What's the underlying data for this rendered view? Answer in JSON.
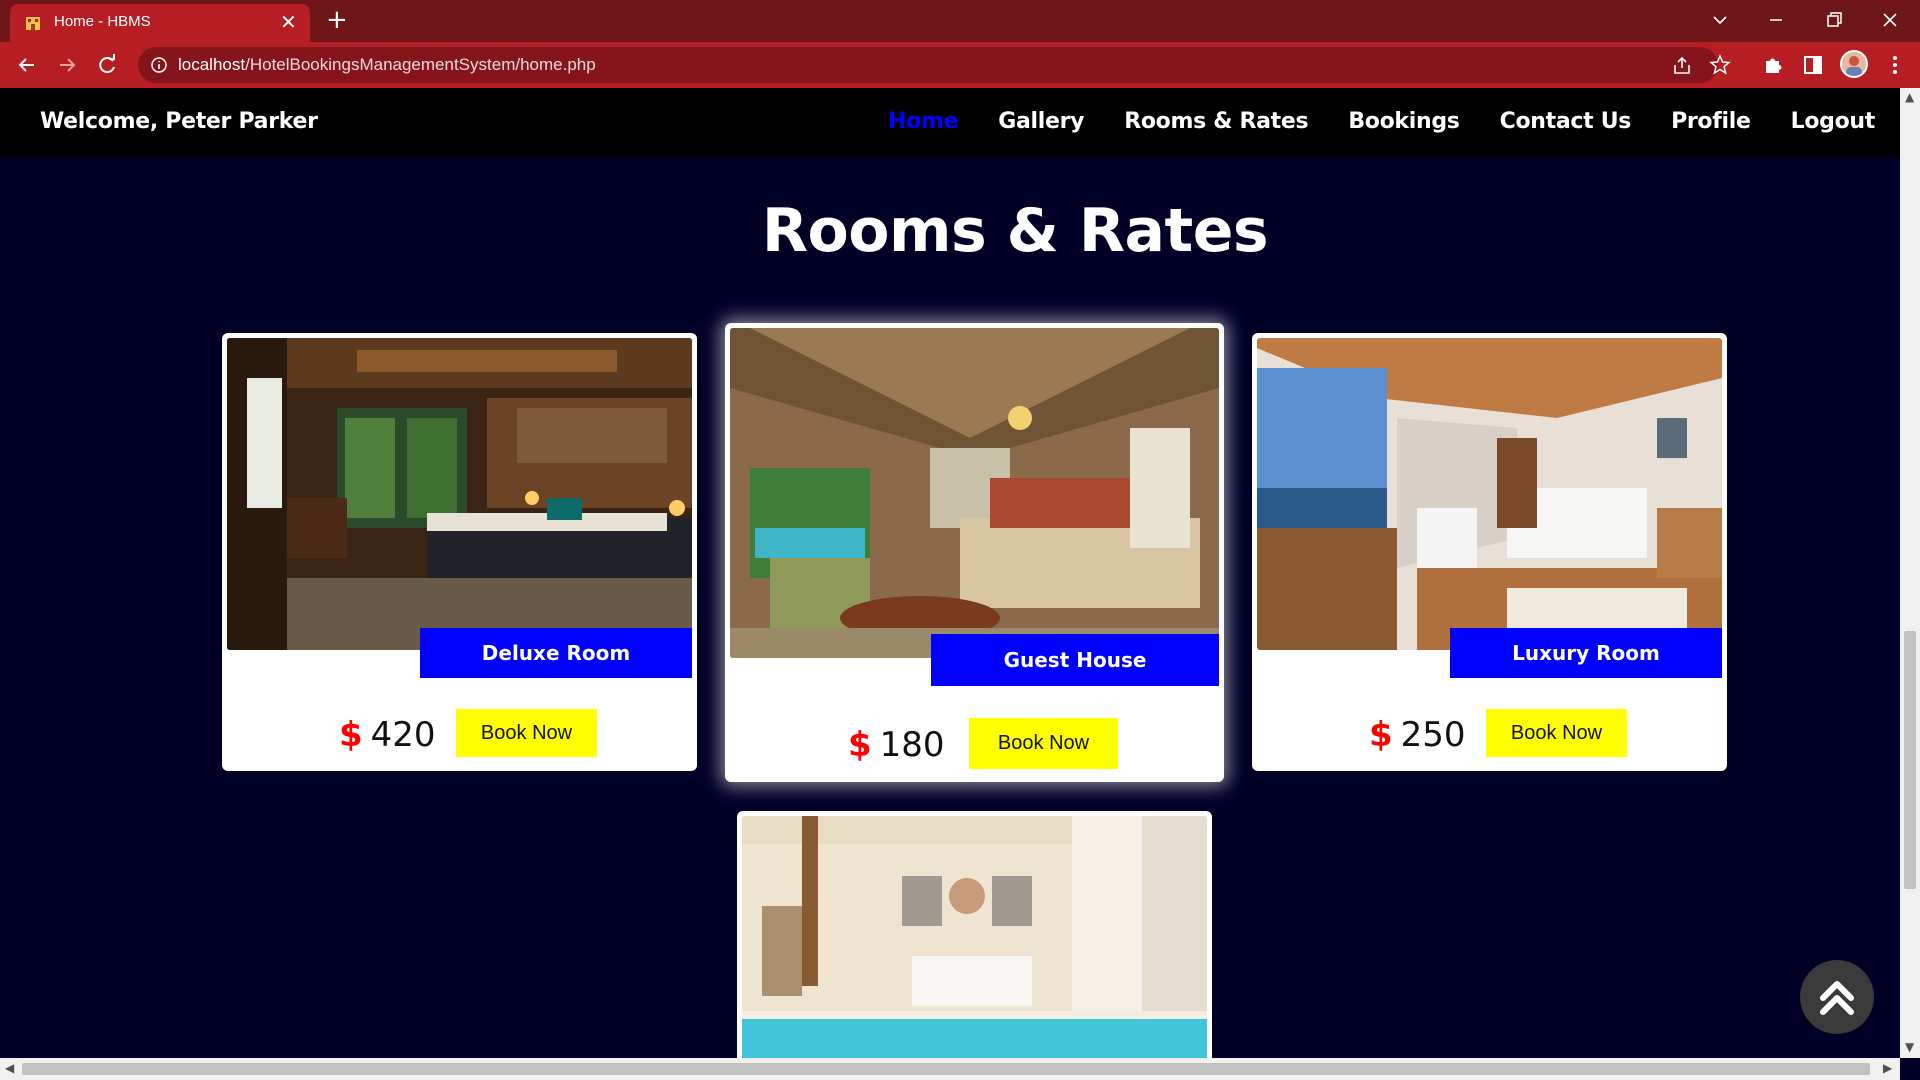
{
  "browser": {
    "tab_title": "Home - HBMS",
    "url_host": "localhost",
    "url_path": "/HotelBookingsManagementSystem/home.php"
  },
  "navbar": {
    "welcome": "Welcome, Peter Parker",
    "links": [
      "Home",
      "Gallery",
      "Rooms & Rates",
      "Bookings",
      "Contact Us",
      "Profile",
      "Logout"
    ],
    "active": "Home"
  },
  "section": {
    "title": "Rooms & Rates"
  },
  "rooms": [
    {
      "name": "Deluxe Room",
      "currency": "$",
      "price": "420",
      "button": "Book Now"
    },
    {
      "name": "Guest House",
      "currency": "$",
      "price": "180",
      "button": "Book Now"
    },
    {
      "name": "Luxury Room",
      "currency": "$",
      "price": "250",
      "button": "Book Now"
    }
  ],
  "colors": {
    "page_bg": "#000027",
    "accent_blue": "#0000ff",
    "button_yellow": "#ffff00",
    "price_red": "#ff0000",
    "browser_red": "#b61e24"
  }
}
